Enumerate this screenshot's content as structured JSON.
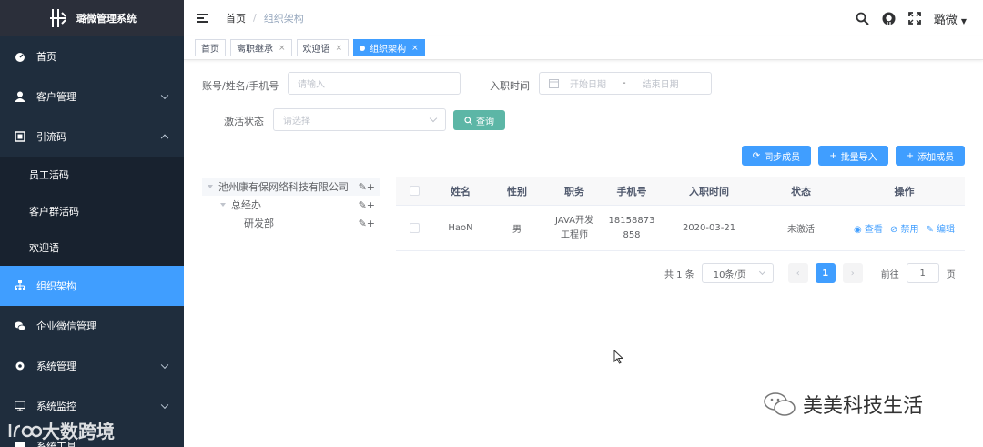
{
  "app": {
    "title": "璐微管理系统"
  },
  "sidebar": {
    "items": [
      {
        "label": "首页",
        "icon": "dashboard-icon"
      },
      {
        "label": "客户管理",
        "icon": "user-icon"
      },
      {
        "label": "引流码",
        "icon": "qrcode-icon"
      },
      {
        "label": "员工活码"
      },
      {
        "label": "客户群活码"
      },
      {
        "label": "欢迎语"
      },
      {
        "label": "组织架构",
        "icon": "tree-icon"
      },
      {
        "label": "企业微信管理",
        "icon": "wechat-icon"
      },
      {
        "label": "系统管理",
        "icon": "gear-icon"
      },
      {
        "label": "系统监控",
        "icon": "monitor-icon"
      },
      {
        "label": "系统工具",
        "icon": "tool-icon"
      }
    ],
    "watermark": "大数跨境"
  },
  "header": {
    "breadcrumb": [
      "首页",
      "组织架构"
    ],
    "separator": "/",
    "user": "璐微"
  },
  "tags": [
    {
      "label": "首页"
    },
    {
      "label": "离职继承",
      "close": "×"
    },
    {
      "label": "欢迎语",
      "close": "×"
    },
    {
      "label": "组织架构",
      "close": "×"
    }
  ],
  "form": {
    "account_label": "账号/姓名/手机号",
    "account_placeholder": "请输入",
    "join_label": "入职时间",
    "start_placeholder": "开始日期",
    "range_sep": "-",
    "end_placeholder": "结束日期",
    "status_label": "激活状态",
    "status_placeholder": "请选择",
    "search_button": "查询"
  },
  "toolbar": {
    "sync": "同步成员",
    "import": "批量导入",
    "add": "添加成员"
  },
  "tree": [
    {
      "label": "池州康有保网络科技有限公司",
      "ops": "✎+"
    },
    {
      "label": "总经办",
      "ops": "✎+"
    },
    {
      "label": "研发部",
      "ops": "✎+"
    }
  ],
  "table": {
    "headers": [
      "姓名",
      "性别",
      "职务",
      "手机号",
      "入职时间",
      "状态",
      "操作"
    ],
    "rows": [
      {
        "name": "HaoN",
        "gender": "男",
        "job1": "JAVA开发",
        "job2": "工程师",
        "phone1": "18158873",
        "phone2": "858",
        "date": "2020-03-21",
        "status": "未激活",
        "view": "查看",
        "disable": "禁用",
        "edit": "编辑"
      }
    ]
  },
  "pager": {
    "total": "共 1 条",
    "size": "10条/页",
    "current": "1",
    "goto": "前往",
    "goto_value": "1",
    "page_unit": "页"
  },
  "watermark_right": "美美科技生活",
  "colors": {
    "primary": "#409eff",
    "sidebar": "#1f2d3d",
    "search": "#5cb6a6"
  }
}
